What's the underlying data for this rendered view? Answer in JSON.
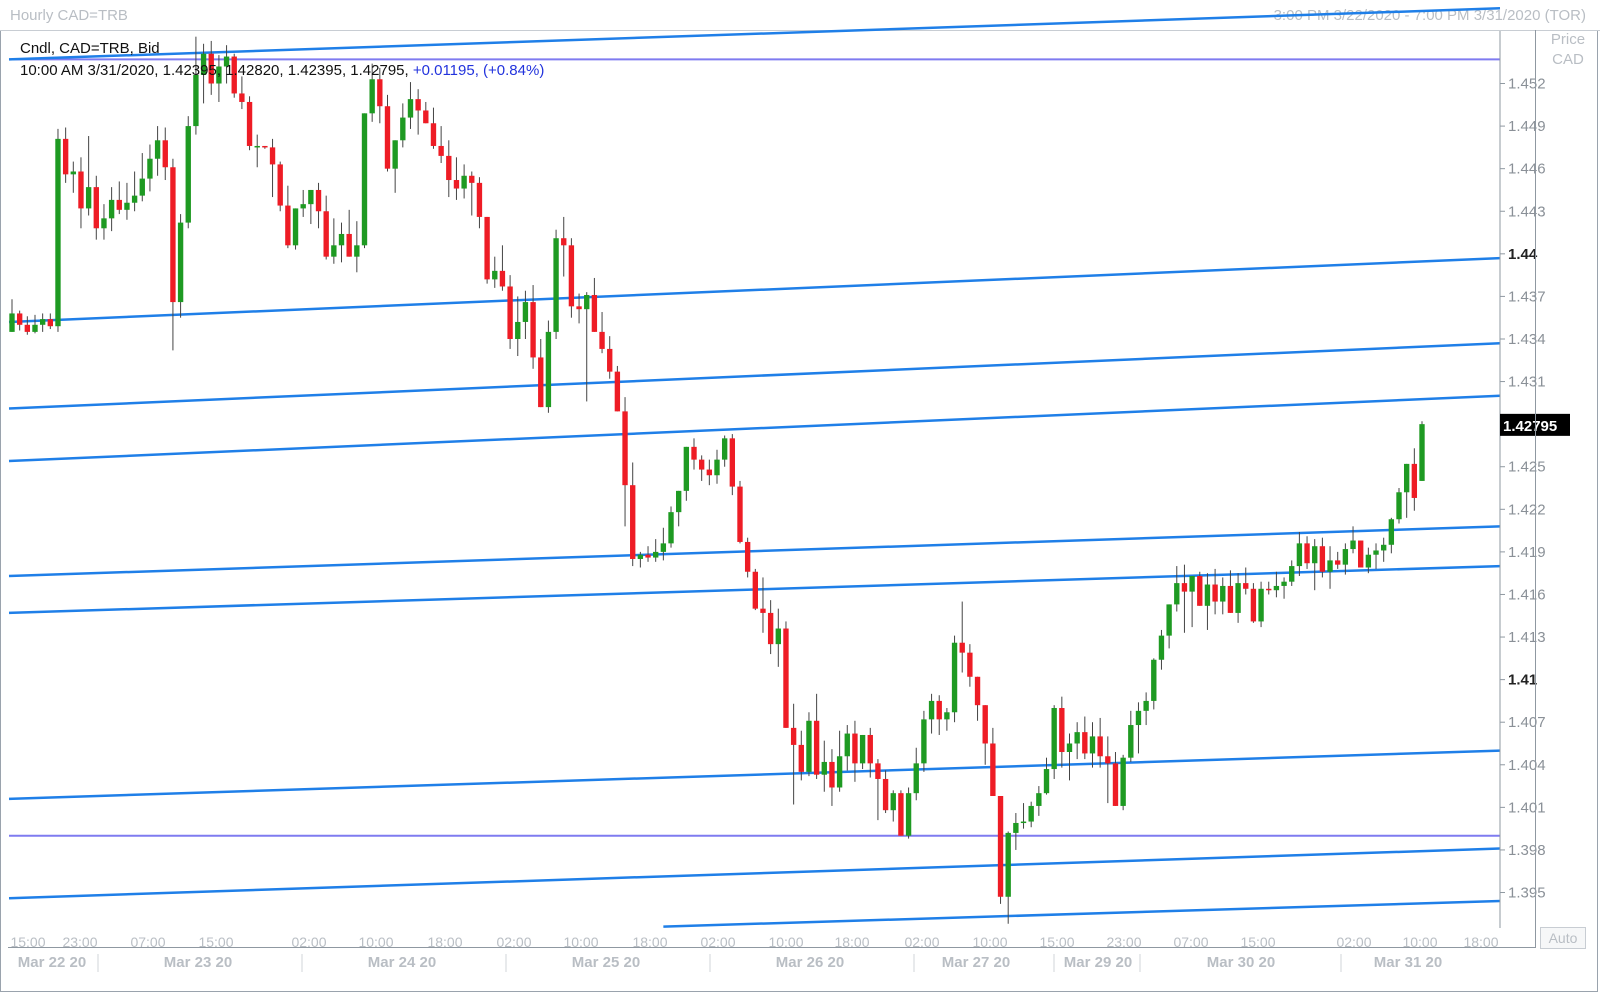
{
  "header": {
    "title": "Hourly CAD=TRB",
    "range": "3:00 PM 3/22/2020 - 7:00 PM 3/31/2020 (TOR)"
  },
  "legend": {
    "line1": "Cndl, CAD=TRB, Bid",
    "line2_prefix": "10:00 AM 3/31/2020, 1.42395, 1.42820, 1.42395, 1.42795,",
    "line2_change": "+0.01195, (+0.84%)"
  },
  "axis": {
    "price_label": "Price",
    "currency_label": "CAD",
    "last_price": "1.42795",
    "auto_label": "Auto"
  },
  "colors": {
    "up": "#1e9a22",
    "down": "#ee1c25",
    "trend": "#1f7fe8",
    "horizontal": "#7f7bf0",
    "last_price_bg": "#000000"
  },
  "chart_data": {
    "type": "candlestick",
    "title": "Hourly CAD=TRB",
    "ylabel": "Price CAD",
    "ylim": [
      1.3925,
      1.4557
    ],
    "y_ticks": [
      "1.452",
      "1.449",
      "1.446",
      "1.443",
      "1.44",
      "1.437",
      "1.434",
      "1.431",
      "1.428",
      "1.425",
      "1.422",
      "1.419",
      "1.416",
      "1.413",
      "1.41",
      "1.407",
      "1.404",
      "1.401",
      "1.398",
      "1.395"
    ],
    "y_ticks_bold": [
      "1.44",
      "1.41"
    ],
    "x_time_labels": [
      "15:00",
      "23:00",
      "07:00",
      "15:00",
      "02:00",
      "10:00",
      "18:00",
      "02:00",
      "10:00",
      "18:00",
      "02:00",
      "10:00",
      "18:00",
      "02:00",
      "10:00",
      "15:00",
      "23:00",
      "07:00",
      "15:00",
      "02:00",
      "10:00",
      "18:00"
    ],
    "x_date_labels": [
      "Mar 22 20",
      "Mar 23 20",
      "Mar 24 20",
      "Mar 25 20",
      "Mar 26 20",
      "Mar 27 20",
      "Mar 29 20",
      "Mar 30 20",
      "Mar 31 20"
    ],
    "last_close": 1.42795,
    "horizontal_levels": [
      1.4537,
      1.399
    ],
    "trend_lines": [
      {
        "from_bar": 0,
        "y1": 1.4537,
        "to_bar": 999,
        "y2": 1.4573
      },
      {
        "from_bar": 0,
        "y1": 1.4352,
        "to_bar": 999,
        "y2": 1.4397
      },
      {
        "from_bar": 0,
        "y1": 1.4291,
        "to_bar": 999,
        "y2": 1.4337
      },
      {
        "from_bar": 0,
        "y1": 1.4254,
        "to_bar": 999,
        "y2": 1.43
      },
      {
        "from_bar": 0,
        "y1": 1.4173,
        "to_bar": 999,
        "y2": 1.4208
      },
      {
        "from_bar": 0,
        "y1": 1.4147,
        "to_bar": 999,
        "y2": 1.418
      },
      {
        "from_bar": 0,
        "y1": 1.4016,
        "to_bar": 999,
        "y2": 1.405
      },
      {
        "from_bar": 0,
        "y1": 1.3946,
        "to_bar": 999,
        "y2": 1.3981
      },
      {
        "from_bar": 85,
        "y1": 1.3926,
        "to_bar": 999,
        "y2": 1.3944
      }
    ],
    "candles": [
      [
        1.4345,
        1.4368,
        1.4346,
        1.4358
      ],
      [
        1.4358,
        1.436,
        1.4346,
        1.435
      ],
      [
        1.435,
        1.4356,
        1.4343,
        1.4345
      ],
      [
        1.4345,
        1.4357,
        1.4344,
        1.435
      ],
      [
        1.435,
        1.4358,
        1.4345,
        1.4354
      ],
      [
        1.4354,
        1.4358,
        1.4347,
        1.4349
      ],
      [
        1.4349,
        1.4488,
        1.4345,
        1.4481
      ],
      [
        1.4481,
        1.4489,
        1.445,
        1.4456
      ],
      [
        1.4456,
        1.4465,
        1.4443,
        1.4458
      ],
      [
        1.4458,
        1.4468,
        1.4418,
        1.4432
      ],
      [
        1.4432,
        1.4483,
        1.4427,
        1.4447
      ],
      [
        1.4447,
        1.4455,
        1.441,
        1.4418
      ],
      [
        1.4418,
        1.4435,
        1.441,
        1.4425
      ],
      [
        1.4425,
        1.4447,
        1.4416,
        1.4438
      ],
      [
        1.4438,
        1.4451,
        1.4428,
        1.4431
      ],
      [
        1.4431,
        1.445,
        1.4424,
        1.4436
      ],
      [
        1.4436,
        1.4458,
        1.443,
        1.4441
      ],
      [
        1.4441,
        1.4471,
        1.4437,
        1.4453
      ],
      [
        1.4453,
        1.4477,
        1.4444,
        1.4467
      ],
      [
        1.4467,
        1.449,
        1.4455,
        1.448
      ],
      [
        1.448,
        1.4489,
        1.4452,
        1.4461
      ],
      [
        1.4461,
        1.4467,
        1.4332,
        1.4366
      ],
      [
        1.4366,
        1.4428,
        1.4355,
        1.4422
      ],
      [
        1.4422,
        1.4497,
        1.4418,
        1.449
      ],
      [
        1.449,
        1.4553,
        1.4484,
        1.4526
      ],
      [
        1.4526,
        1.4548,
        1.4506,
        1.4541
      ],
      [
        1.4541,
        1.455,
        1.4512,
        1.452
      ],
      [
        1.452,
        1.454,
        1.4507,
        1.4532
      ],
      [
        1.4532,
        1.4547,
        1.452,
        1.4539
      ],
      [
        1.4539,
        1.4541,
        1.451,
        1.4513
      ],
      [
        1.4513,
        1.4525,
        1.4502,
        1.4507
      ],
      [
        1.4507,
        1.4511,
        1.4473,
        1.4476
      ],
      [
        1.4476,
        1.4484,
        1.4461,
        1.4476
      ],
      [
        1.4476,
        1.4476,
        1.4474,
        1.4475
      ],
      [
        1.4475,
        1.4481,
        1.444,
        1.4463
      ],
      [
        1.4463,
        1.4465,
        1.443,
        1.4434
      ],
      [
        1.4434,
        1.4448,
        1.4404,
        1.4406
      ],
      [
        1.4406,
        1.4427,
        1.4403,
        1.4432
      ],
      [
        1.4432,
        1.4445,
        1.4426,
        1.4435
      ],
      [
        1.4435,
        1.4444,
        1.4421,
        1.4445
      ],
      [
        1.4445,
        1.445,
        1.4418,
        1.443
      ],
      [
        1.443,
        1.4441,
        1.4396,
        1.4398
      ],
      [
        1.4398,
        1.4425,
        1.4393,
        1.4406
      ],
      [
        1.4406,
        1.4422,
        1.4394,
        1.4414
      ],
      [
        1.4414,
        1.4431,
        1.4404,
        1.4398
      ],
      [
        1.4398,
        1.4423,
        1.4387,
        1.4406
      ],
      [
        1.4406,
        1.4471,
        1.4404,
        1.4499
      ],
      [
        1.4499,
        1.4534,
        1.4493,
        1.4523
      ],
      [
        1.4523,
        1.4531,
        1.4492,
        1.4504
      ],
      [
        1.4504,
        1.4512,
        1.4458,
        1.446
      ],
      [
        1.446,
        1.4476,
        1.4443,
        1.448
      ],
      [
        1.448,
        1.4506,
        1.4475,
        1.4496
      ],
      [
        1.4496,
        1.4521,
        1.4488,
        1.4509
      ],
      [
        1.4509,
        1.4516,
        1.4484,
        1.4501
      ],
      [
        1.4501,
        1.4507,
        1.4492,
        1.4492
      ],
      [
        1.4492,
        1.4503,
        1.4474,
        1.4476
      ],
      [
        1.4476,
        1.449,
        1.4464,
        1.4469
      ],
      [
        1.4469,
        1.448,
        1.444,
        1.4452
      ],
      [
        1.4452,
        1.4468,
        1.4438,
        1.4446
      ],
      [
        1.4446,
        1.4463,
        1.4439,
        1.4455
      ],
      [
        1.4455,
        1.4458,
        1.4427,
        1.445
      ],
      [
        1.445,
        1.4454,
        1.4418,
        1.4426
      ],
      [
        1.4426,
        1.4426,
        1.4379,
        1.4382
      ],
      [
        1.4382,
        1.4398,
        1.4376,
        1.4388
      ],
      [
        1.4388,
        1.4406,
        1.4374,
        1.4377
      ],
      [
        1.4377,
        1.4385,
        1.4333,
        1.434
      ],
      [
        1.434,
        1.437,
        1.4328,
        1.4352
      ],
      [
        1.4352,
        1.4374,
        1.434,
        1.4366
      ],
      [
        1.4366,
        1.4378,
        1.4319,
        1.4327
      ],
      [
        1.4327,
        1.434,
        1.43,
        1.4292
      ],
      [
        1.4292,
        1.4353,
        1.4288,
        1.4345
      ],
      [
        1.4345,
        1.4417,
        1.434,
        1.4411
      ],
      [
        1.4411,
        1.4426,
        1.4384,
        1.4406
      ],
      [
        1.4406,
        1.4411,
        1.4355,
        1.4363
      ],
      [
        1.4363,
        1.4372,
        1.4351,
        1.4361
      ],
      [
        1.4361,
        1.4373,
        1.4296,
        1.4371
      ],
      [
        1.4371,
        1.4383,
        1.4349,
        1.4345
      ],
      [
        1.4345,
        1.4359,
        1.433,
        1.4333
      ],
      [
        1.4333,
        1.4342,
        1.4312,
        1.4317
      ],
      [
        1.4317,
        1.4321,
        1.4291,
        1.4289
      ],
      [
        1.4289,
        1.4299,
        1.4208,
        1.4237
      ],
      [
        1.4237,
        1.4253,
        1.418,
        1.4185
      ],
      [
        1.4185,
        1.419,
        1.4179,
        1.4188
      ],
      [
        1.4188,
        1.4194,
        1.4183,
        1.4186
      ],
      [
        1.4186,
        1.4199,
        1.4183,
        1.419
      ],
      [
        1.419,
        1.4207,
        1.4184,
        1.4196
      ],
      [
        1.4196,
        1.4222,
        1.4193,
        1.4218
      ],
      [
        1.4218,
        1.4229,
        1.4208,
        1.4233
      ],
      [
        1.4233,
        1.4259,
        1.4226,
        1.4264
      ],
      [
        1.4264,
        1.427,
        1.4248,
        1.4255
      ],
      [
        1.4255,
        1.4258,
        1.424,
        1.4248
      ],
      [
        1.4248,
        1.4255,
        1.4237,
        1.4244
      ],
      [
        1.4244,
        1.4262,
        1.4238,
        1.4255
      ],
      [
        1.4255,
        1.4272,
        1.425,
        1.427
      ],
      [
        1.427,
        1.4273,
        1.423,
        1.4236
      ],
      [
        1.4236,
        1.424,
        1.4196,
        1.4197
      ],
      [
        1.4197,
        1.42,
        1.4172,
        1.4176
      ],
      [
        1.4176,
        1.4178,
        1.4149,
        1.415
      ],
      [
        1.415,
        1.4172,
        1.4133,
        1.4147
      ],
      [
        1.4147,
        1.4156,
        1.4118,
        1.4125
      ],
      [
        1.4125,
        1.415,
        1.4109,
        1.4136
      ],
      [
        1.4136,
        1.4141,
        1.4072,
        1.4066
      ],
      [
        1.4066,
        1.4083,
        1.4012,
        1.4054
      ],
      [
        1.4054,
        1.4064,
        1.4029,
        1.4035
      ],
      [
        1.4035,
        1.4077,
        1.4032,
        1.4071
      ],
      [
        1.4071,
        1.409,
        1.403,
        1.4033
      ],
      [
        1.4033,
        1.4057,
        1.4021,
        1.4042
      ],
      [
        1.4042,
        1.4051,
        1.4011,
        1.4024
      ],
      [
        1.4024,
        1.4064,
        1.4021,
        1.4046
      ],
      [
        1.4046,
        1.4068,
        1.4036,
        1.4062
      ],
      [
        1.4062,
        1.4071,
        1.4028,
        1.4041
      ],
      [
        1.4041,
        1.4053,
        1.4037,
        1.4061
      ],
      [
        1.4061,
        1.4066,
        1.4031,
        1.4041
      ],
      [
        1.4041,
        1.4044,
        1.4001,
        1.403
      ],
      [
        1.403,
        1.4036,
        1.4006,
        1.4008
      ],
      [
        1.4008,
        1.4022,
        1.4,
        1.402
      ],
      [
        1.402,
        1.4022,
        1.399,
        1.399
      ],
      [
        1.399,
        1.4024,
        1.3988,
        1.402
      ],
      [
        1.402,
        1.4052,
        1.4015,
        1.4041
      ],
      [
        1.4041,
        1.4078,
        1.4035,
        1.4072
      ],
      [
        1.4072,
        1.409,
        1.4062,
        1.4085
      ],
      [
        1.4085,
        1.4089,
        1.4061,
        1.4072
      ],
      [
        1.4072,
        1.408,
        1.4064,
        1.4077
      ],
      [
        1.4077,
        1.4131,
        1.407,
        1.4126
      ],
      [
        1.4126,
        1.4155,
        1.4105,
        1.4119
      ],
      [
        1.4119,
        1.4125,
        1.4095,
        1.4102
      ],
      [
        1.4102,
        1.4101,
        1.4071,
        1.4082
      ],
      [
        1.4082,
        1.4075,
        1.404,
        1.4055
      ],
      [
        1.4055,
        1.4066,
        1.4032,
        1.4018
      ],
      [
        1.4018,
        1.4005,
        1.3942,
        1.3947
      ],
      [
        1.3947,
        1.3993,
        1.3928,
        1.3992
      ],
      [
        1.3992,
        1.4006,
        1.398,
        1.3999
      ],
      [
        1.3999,
        1.4013,
        1.3995,
        1.4
      ],
      [
        1.4,
        1.4014,
        1.3996,
        1.4011
      ],
      [
        1.4011,
        1.4025,
        1.4004,
        1.402
      ],
      [
        1.402,
        1.4045,
        1.4019,
        1.4037
      ],
      [
        1.4037,
        1.4082,
        1.403,
        1.408
      ],
      [
        1.408,
        1.4088,
        1.4038,
        1.4049
      ],
      [
        1.4049,
        1.4062,
        1.4029,
        1.4055
      ],
      [
        1.4055,
        1.407,
        1.4044,
        1.4063
      ],
      [
        1.4063,
        1.4074,
        1.4044,
        1.4048
      ],
      [
        1.4048,
        1.407,
        1.4038,
        1.406
      ],
      [
        1.406,
        1.4073,
        1.4038,
        1.4046
      ],
      [
        1.4046,
        1.406,
        1.4013,
        1.4041
      ],
      [
        1.4041,
        1.4049,
        1.4012,
        1.4011
      ],
      [
        1.4011,
        1.4047,
        1.4008,
        1.4045
      ],
      [
        1.4045,
        1.4078,
        1.4042,
        1.4068
      ],
      [
        1.4068,
        1.4084,
        1.4048,
        1.4078
      ],
      [
        1.4078,
        1.4091,
        1.4068,
        1.4085
      ],
      [
        1.4085,
        1.4115,
        1.4079,
        1.4114
      ],
      [
        1.4114,
        1.4135,
        1.4107,
        1.4131
      ],
      [
        1.4131,
        1.4153,
        1.4122,
        1.4153
      ],
      [
        1.4153,
        1.418,
        1.4148,
        1.4168
      ],
      [
        1.4168,
        1.4181,
        1.4133,
        1.4162
      ],
      [
        1.4162,
        1.4173,
        1.4137,
        1.4173
      ],
      [
        1.4173,
        1.4176,
        1.416,
        1.4152
      ],
      [
        1.4152,
        1.4175,
        1.4135,
        1.4167
      ],
      [
        1.4167,
        1.4178,
        1.4146,
        1.4155
      ],
      [
        1.4155,
        1.4172,
        1.4146,
        1.4166
      ],
      [
        1.4166,
        1.4177,
        1.4152,
        1.4147
      ],
      [
        1.4147,
        1.4175,
        1.414,
        1.4168
      ],
      [
        1.4168,
        1.4179,
        1.416,
        1.4164
      ],
      [
        1.4164,
        1.4168,
        1.414,
        1.4141
      ],
      [
        1.4141,
        1.4169,
        1.4137,
        1.4164
      ],
      [
        1.4164,
        1.4169,
        1.416,
        1.4163
      ],
      [
        1.4163,
        1.4176,
        1.4158,
        1.4166
      ],
      [
        1.4166,
        1.4172,
        1.4157,
        1.4169
      ],
      [
        1.4169,
        1.4184,
        1.4166,
        1.418
      ],
      [
        1.418,
        1.4204,
        1.4173,
        1.4196
      ],
      [
        1.4196,
        1.4201,
        1.4178,
        1.4182
      ],
      [
        1.4182,
        1.4199,
        1.4163,
        1.4194
      ],
      [
        1.4194,
        1.42,
        1.4172,
        1.4176
      ],
      [
        1.4176,
        1.4194,
        1.4164,
        1.4184
      ],
      [
        1.4184,
        1.419,
        1.4178,
        1.4181
      ],
      [
        1.4181,
        1.4196,
        1.4174,
        1.4192
      ],
      [
        1.4192,
        1.4208,
        1.4189,
        1.4198
      ],
      [
        1.4198,
        1.4196,
        1.418,
        1.4179
      ],
      [
        1.4179,
        1.4193,
        1.4175,
        1.4188
      ],
      [
        1.4188,
        1.4196,
        1.4178,
        1.4191
      ],
      [
        1.4191,
        1.42,
        1.4183,
        1.4195
      ],
      [
        1.4195,
        1.4214,
        1.4189,
        1.4213
      ],
      [
        1.4213,
        1.4235,
        1.421,
        1.4232
      ],
      [
        1.4232,
        1.4245,
        1.4214,
        1.4252
      ],
      [
        1.4252,
        1.4263,
        1.4219,
        1.4228
      ],
      [
        1.424,
        1.4282,
        1.424,
        1.428
      ]
    ]
  }
}
